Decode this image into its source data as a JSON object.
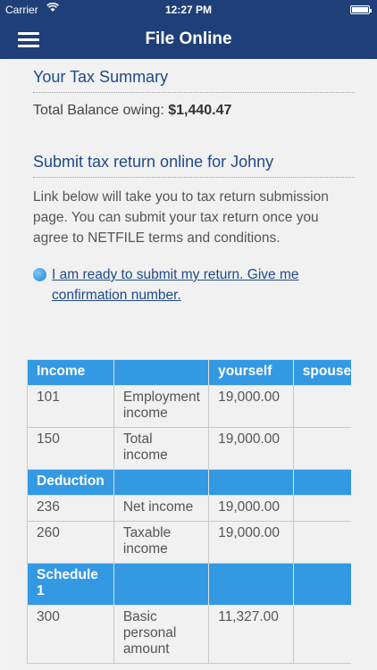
{
  "status": {
    "carrier": "Carrier",
    "time": "12:27 PM",
    "battery_level": 1.0
  },
  "nav": {
    "title": "File Online",
    "menu_icon": "hamburger-menu-icon"
  },
  "summary": {
    "title": "Your Tax Summary",
    "balance_label": "Total Balance owing:",
    "balance_value": "$1,440.47"
  },
  "submit": {
    "title": "Submit tax return online for Johny",
    "description": "Link below will take you to tax return submission page. You can submit your tax return once you agree to NETFILE terms and conditions.",
    "link_text": "I am ready to submit my return. Give me confirmation number."
  },
  "table": {
    "headers": [
      "Income",
      "",
      "yourself",
      "spouse"
    ],
    "rows": [
      {
        "type": "row",
        "cells": [
          "101",
          "Employment income",
          "19,000.00",
          ""
        ]
      },
      {
        "type": "row",
        "cells": [
          "150",
          "Total income",
          "19,000.00",
          ""
        ]
      },
      {
        "type": "section",
        "cells": [
          "Deduction",
          "",
          "",
          ""
        ]
      },
      {
        "type": "row",
        "cells": [
          "236",
          "Net income",
          "19,000.00",
          ""
        ]
      },
      {
        "type": "row",
        "cells": [
          "260",
          "Taxable income",
          "19,000.00",
          ""
        ]
      },
      {
        "type": "section",
        "cells": [
          "Schedule 1",
          "",
          "",
          ""
        ]
      },
      {
        "type": "row",
        "cells": [
          "300",
          "Basic personal amount",
          "11,327.00",
          ""
        ]
      }
    ]
  },
  "colors": {
    "nav_bg": "#1f3f78",
    "accent": "#3399e3",
    "title_text": "#1f4a8a"
  }
}
